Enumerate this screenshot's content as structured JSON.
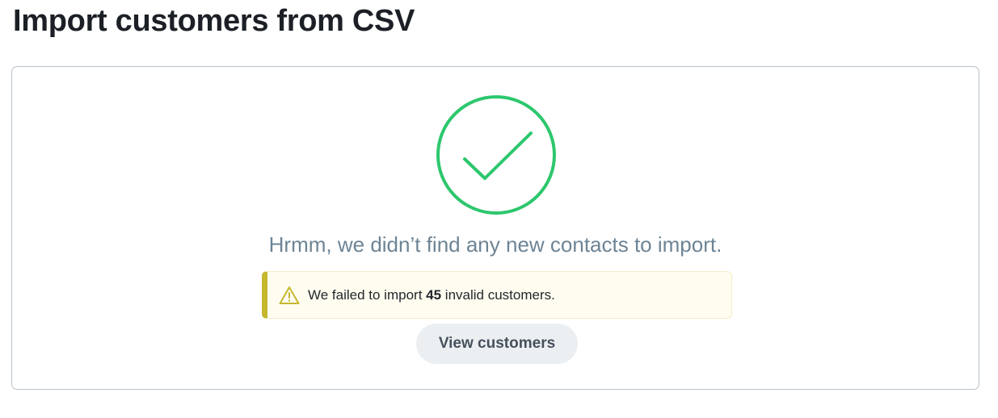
{
  "page": {
    "title": "Import customers from CSV"
  },
  "result": {
    "icon": "check-circle-icon",
    "message": "Hrmm, we didn’t find any new contacts to import."
  },
  "warning": {
    "icon": "warning-triangle-icon",
    "prefix": "We failed to import ",
    "count": "45",
    "suffix": " invalid customers."
  },
  "actions": {
    "view_customers_label": "View customers"
  },
  "colors": {
    "success": "#2dc76d",
    "warning_accent": "#c6b72f",
    "warning_background": "#fffdf0",
    "message_text": "#6d8495",
    "button_background": "#eceff2"
  }
}
